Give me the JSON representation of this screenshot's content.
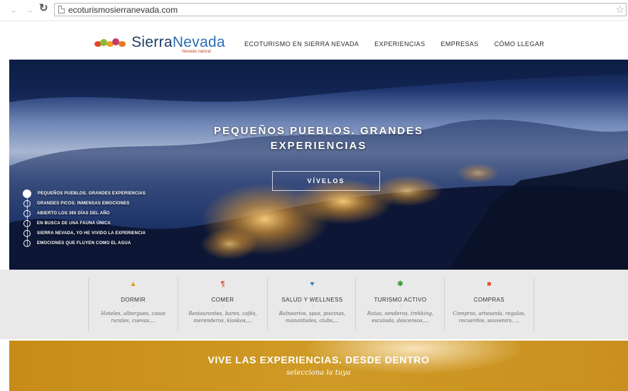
{
  "browser": {
    "url": "ecoturismosierranevada.com"
  },
  "header": {
    "logo_primary": "Sierra",
    "logo_secondary": "Nevada",
    "logo_tagline": "Nevada natural",
    "nav": [
      {
        "label": "ECOTURISMO EN SIERRA NEVADA"
      },
      {
        "label": "EXPERIENCIAS"
      },
      {
        "label": "EMPRESAS"
      },
      {
        "label": "CÓMO LLEGAR"
      }
    ]
  },
  "hero": {
    "title_line1": "PEQUEÑOS PUEBLOS. GRANDES",
    "title_line2": "EXPERIENCIAS",
    "cta_label": "VÍVELOS",
    "slides": [
      {
        "label": "PEQUEÑOS PUEBLOS. GRANDES EXPERIENCIAS",
        "active": true
      },
      {
        "label": "GRANDES PICOS. INMENSAS EMOCIONES",
        "active": false
      },
      {
        "label": "ABIERTO LOS 365 DÍAS DEL AÑO",
        "active": false
      },
      {
        "label": "EN BUSCA DE UNA FAUNA ÚNICA",
        "active": false
      },
      {
        "label": "SIERRA NEVADA, YO HE VIVIDO LA EXPERIENCIA",
        "active": false
      },
      {
        "label": "EMOCIONES QUE FLUYEN COMO EL AGUA",
        "active": false
      }
    ]
  },
  "categories": [
    {
      "icon": "house-icon",
      "title": "DORMIR",
      "dash": "-",
      "desc_line1": "Hoteles, albergues, casas",
      "desc_line2": "rurales, cuevas,...",
      "color": "#e8941f"
    },
    {
      "icon": "fork-knife-icon",
      "title": "COMER",
      "dash": "-",
      "desc_line1": "Restaurantes, bares, cafés,",
      "desc_line2": "merenderos, kioskos,...",
      "color": "#d9432b"
    },
    {
      "icon": "heart-icon",
      "title": "SALUD Y WELLNESS",
      "dash": "-",
      "desc_line1": "Balnearios, spas, piscinas,",
      "desc_line2": "manantiales, clubs,...",
      "color": "#2f7fc4"
    },
    {
      "icon": "hiker-icon",
      "title": "TURISMO ACTIVO",
      "dash": "-",
      "desc_line1": "Rutas, senderos, trekking,",
      "desc_line2": "escalada, descensos,...",
      "color": "#3a9a3a"
    },
    {
      "icon": "basket-icon",
      "title": "COMPRAS",
      "dash": "-",
      "desc_line1": "Compras, artesanía, regalos,",
      "desc_line2": "recuerdos, souvenirs, ...",
      "color": "#d9552b"
    }
  ],
  "banner": {
    "title": "VIVE LAS EXPERIENCIAS. DESDE DENTRO",
    "subtitle": "selecciona la tuya"
  }
}
